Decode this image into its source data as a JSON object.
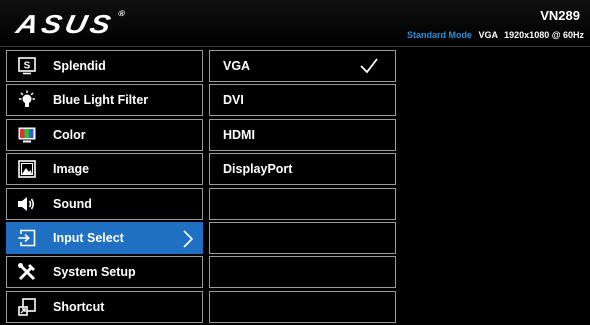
{
  "header": {
    "logo": "ASUS",
    "model": "VN289",
    "status": {
      "mode": "Standard Mode",
      "signal": "VGA",
      "resolution": "1920x1080 @ 60Hz"
    }
  },
  "menu": {
    "items": [
      {
        "label": "Splendid",
        "icon": "splendid-icon",
        "selected": false
      },
      {
        "label": "Blue Light Filter",
        "icon": "bulb-icon",
        "selected": false
      },
      {
        "label": "Color",
        "icon": "color-icon",
        "selected": false
      },
      {
        "label": "Image",
        "icon": "image-icon",
        "selected": false
      },
      {
        "label": "Sound",
        "icon": "speaker-icon",
        "selected": false
      },
      {
        "label": "Input Select",
        "icon": "input-select-icon",
        "selected": true
      },
      {
        "label": "System Setup",
        "icon": "tools-icon",
        "selected": false
      },
      {
        "label": "Shortcut",
        "icon": "shortcut-icon",
        "selected": false
      }
    ]
  },
  "options": {
    "items": [
      {
        "label": "VGA",
        "checked": true
      },
      {
        "label": "DVI",
        "checked": false
      },
      {
        "label": "HDMI",
        "checked": false
      },
      {
        "label": "DisplayPort",
        "checked": false
      },
      {
        "label": "",
        "checked": false
      },
      {
        "label": "",
        "checked": false
      },
      {
        "label": "",
        "checked": false
      },
      {
        "label": "",
        "checked": false
      }
    ]
  },
  "colors": {
    "accent": "#1f6fc2",
    "mode_text": "#2a8fd6",
    "border": "#9a9a9a",
    "background": "#000000"
  }
}
